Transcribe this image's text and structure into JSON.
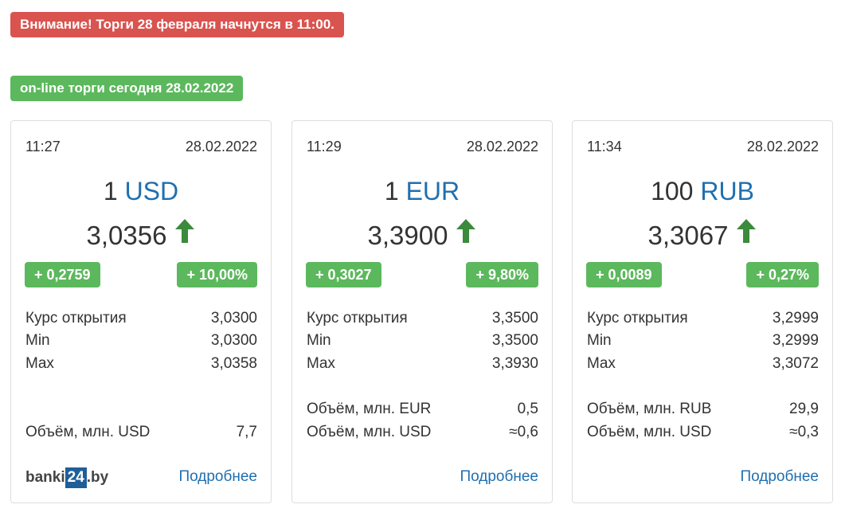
{
  "alert_text": "Внимание! Торги 28 февраля начнутся в 11:00.",
  "online_text": "on-line торги сегодня 28.02.2022",
  "colors": {
    "danger": "#d9534f",
    "success": "#5cb85c",
    "link": "#1f6fb0",
    "up_arrow": "#3c8a3c"
  },
  "cards": [
    {
      "time": "11:27",
      "date": "28.02.2022",
      "amount": "1",
      "currency": "USD",
      "rate": "3,0356",
      "trend_icon": "arrow-up-icon",
      "change_abs": "+ 0,2759",
      "change_pct": "+ 10,00%",
      "rows": [
        {
          "label": "Курс открытия",
          "value": "3,0300"
        },
        {
          "label": "Min",
          "value": "3,0300"
        },
        {
          "label": "Max",
          "value": "3,0358"
        }
      ],
      "volumes": [
        {
          "label": "Объём, млн. USD",
          "value": "7,7"
        }
      ],
      "logo_prefix": "banki",
      "logo_box": "24",
      "logo_suffix": ".by",
      "more_link": "Подробнее"
    },
    {
      "time": "11:29",
      "date": "28.02.2022",
      "amount": "1",
      "currency": "EUR",
      "rate": "3,3900",
      "trend_icon": "arrow-up-icon",
      "change_abs": "+ 0,3027",
      "change_pct": "+ 9,80%",
      "rows": [
        {
          "label": "Курс открытия",
          "value": "3,3500"
        },
        {
          "label": "Min",
          "value": "3,3500"
        },
        {
          "label": "Max",
          "value": "3,3930"
        }
      ],
      "volumes": [
        {
          "label": "Объём, млн. EUR",
          "value": "0,5"
        },
        {
          "label": "Объём, млн. USD",
          "value": "≈0,6"
        }
      ],
      "more_link": "Подробнее"
    },
    {
      "time": "11:34",
      "date": "28.02.2022",
      "amount": "100",
      "currency": "RUB",
      "rate": "3,3067",
      "trend_icon": "arrow-up-icon",
      "change_abs": "+ 0,0089",
      "change_pct": "+ 0,27%",
      "rows": [
        {
          "label": "Курс открытия",
          "value": "3,2999"
        },
        {
          "label": "Min",
          "value": "3,2999"
        },
        {
          "label": "Max",
          "value": "3,3072"
        }
      ],
      "volumes": [
        {
          "label": "Объём, млн. RUB",
          "value": "29,9"
        },
        {
          "label": "Объём, млн. USD",
          "value": "≈0,3"
        }
      ],
      "more_link": "Подробнее"
    }
  ]
}
